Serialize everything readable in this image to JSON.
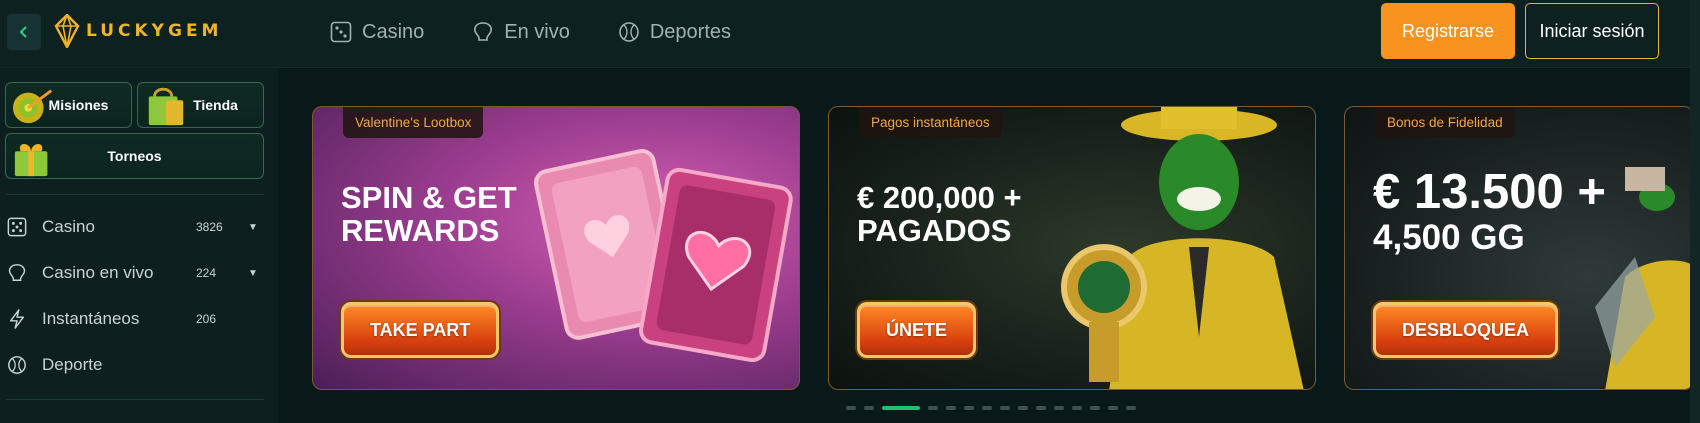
{
  "header": {
    "brand": "LUCKYGEM",
    "nav": [
      {
        "label": "Casino",
        "icon": "dice-icon"
      },
      {
        "label": "En vivo",
        "icon": "live-chip-icon"
      },
      {
        "label": "Deportes",
        "icon": "ball-icon"
      }
    ],
    "register_label": "Registrarse",
    "login_label": "Iniciar sesión"
  },
  "sidebar": {
    "promos": [
      {
        "label": "Misiones"
      },
      {
        "label": "Tienda"
      },
      {
        "label": "Torneos"
      }
    ],
    "items": [
      {
        "label": "Casino",
        "count": "3826",
        "icon": "dice-icon",
        "expandable": true
      },
      {
        "label": "Casino en vivo",
        "count": "224",
        "icon": "live-chip-icon",
        "expandable": true
      },
      {
        "label": "Instantáneos",
        "count": "206",
        "icon": "lightning-icon",
        "expandable": false
      },
      {
        "label": "Deporte",
        "count": "",
        "icon": "ball-icon",
        "expandable": false
      }
    ]
  },
  "banners": [
    {
      "tag": "Valentine's Lootbox",
      "headline_line1": "SPIN & GET",
      "headline_line2": "REWARDS",
      "cta": "TAKE PART"
    },
    {
      "tag": "Pagos instantáneos",
      "headline_line1": "€ 200,000 +",
      "headline_line2": "PAGADOS",
      "cta": "ÚNETE"
    },
    {
      "tag": "Bonos de Fidelidad",
      "headline_line1": "€ 13.500 +",
      "headline_line2": "4,500 GG",
      "cta": "DESBLOQUEA"
    }
  ],
  "carousel": {
    "total_dots": 15,
    "active_index": 2
  },
  "colors": {
    "accent_orange": "#f7931e",
    "accent_gold": "#f0b429",
    "accent_green": "#1fbf74",
    "bg": "#0b1a1a"
  }
}
